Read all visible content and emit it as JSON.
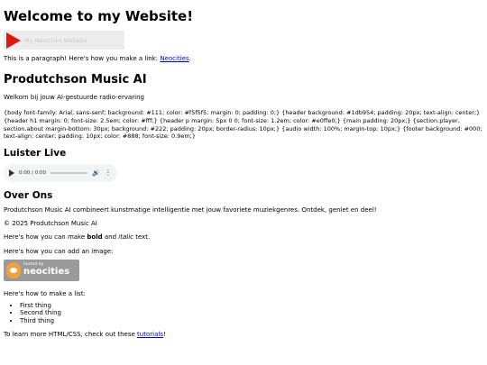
{
  "header": {
    "title": "Welcome to my Website!",
    "banner_text": "My Neocities Website"
  },
  "intro": {
    "text": "This is a paragraph! Here's how you make a link: ",
    "link_label": "Neocities",
    "suffix": "."
  },
  "app": {
    "title": "Produtchson Music AI",
    "welcome": "Welkom bij jouw AI-gestuurde radio-ervaring",
    "css_dump": "{body font-family: Arial, sans-senf; background: #111; color: #f5f5f5; margin: 0; padding: 0;} {header background: #1db954; padding: 20px; text-align: center;} {header h1 margin: 0; font-size: 2.5em; color: #fff;} {header p margin: 5px 0 0; font-size: 1.2em; color: #e0ffe0;} {main padding: 20px;} {section.player, section.about margin-bottom: 30px; background: #222; padding: 20px; border-radius: 10px;} {audio width: 100%; margin-top: 10px;} {footer background: #000; text-align: center; padding: 10px; color: #888; font-size: 0.9em;}"
  },
  "listen": {
    "heading": "Luister Live",
    "time": "0:00 / 0:00",
    "progress": 0
  },
  "about": {
    "heading": "Over Ons",
    "text": "Produtchson Music AI combineert kunstmatige intelligentie met jouw favoriete muziekgenres. Ontdek, geniet en deel!",
    "copyright": "© 2025 Produtchson Music AI"
  },
  "bold_line": {
    "prefix": "Here's how you can make ",
    "bold": "bold",
    "middle": " and ",
    "italic": "italic",
    "suffix": " text."
  },
  "image_line": "Here's how you can add an image:",
  "badge": {
    "small": "hosted by",
    "big": "neocities"
  },
  "list_line": "Here's how to make a list:",
  "list_items": [
    "First thing",
    "Second thing",
    "Third thing"
  ],
  "footer": {
    "prefix": "To learn more HTML/CSS, check out these ",
    "link_label": "tutorials",
    "suffix": "!"
  },
  "colors": {
    "banner_bg": "#ececec",
    "play_red": "#e0190e",
    "link": "#0000cc",
    "badge_bg": "#9a9a9a"
  }
}
